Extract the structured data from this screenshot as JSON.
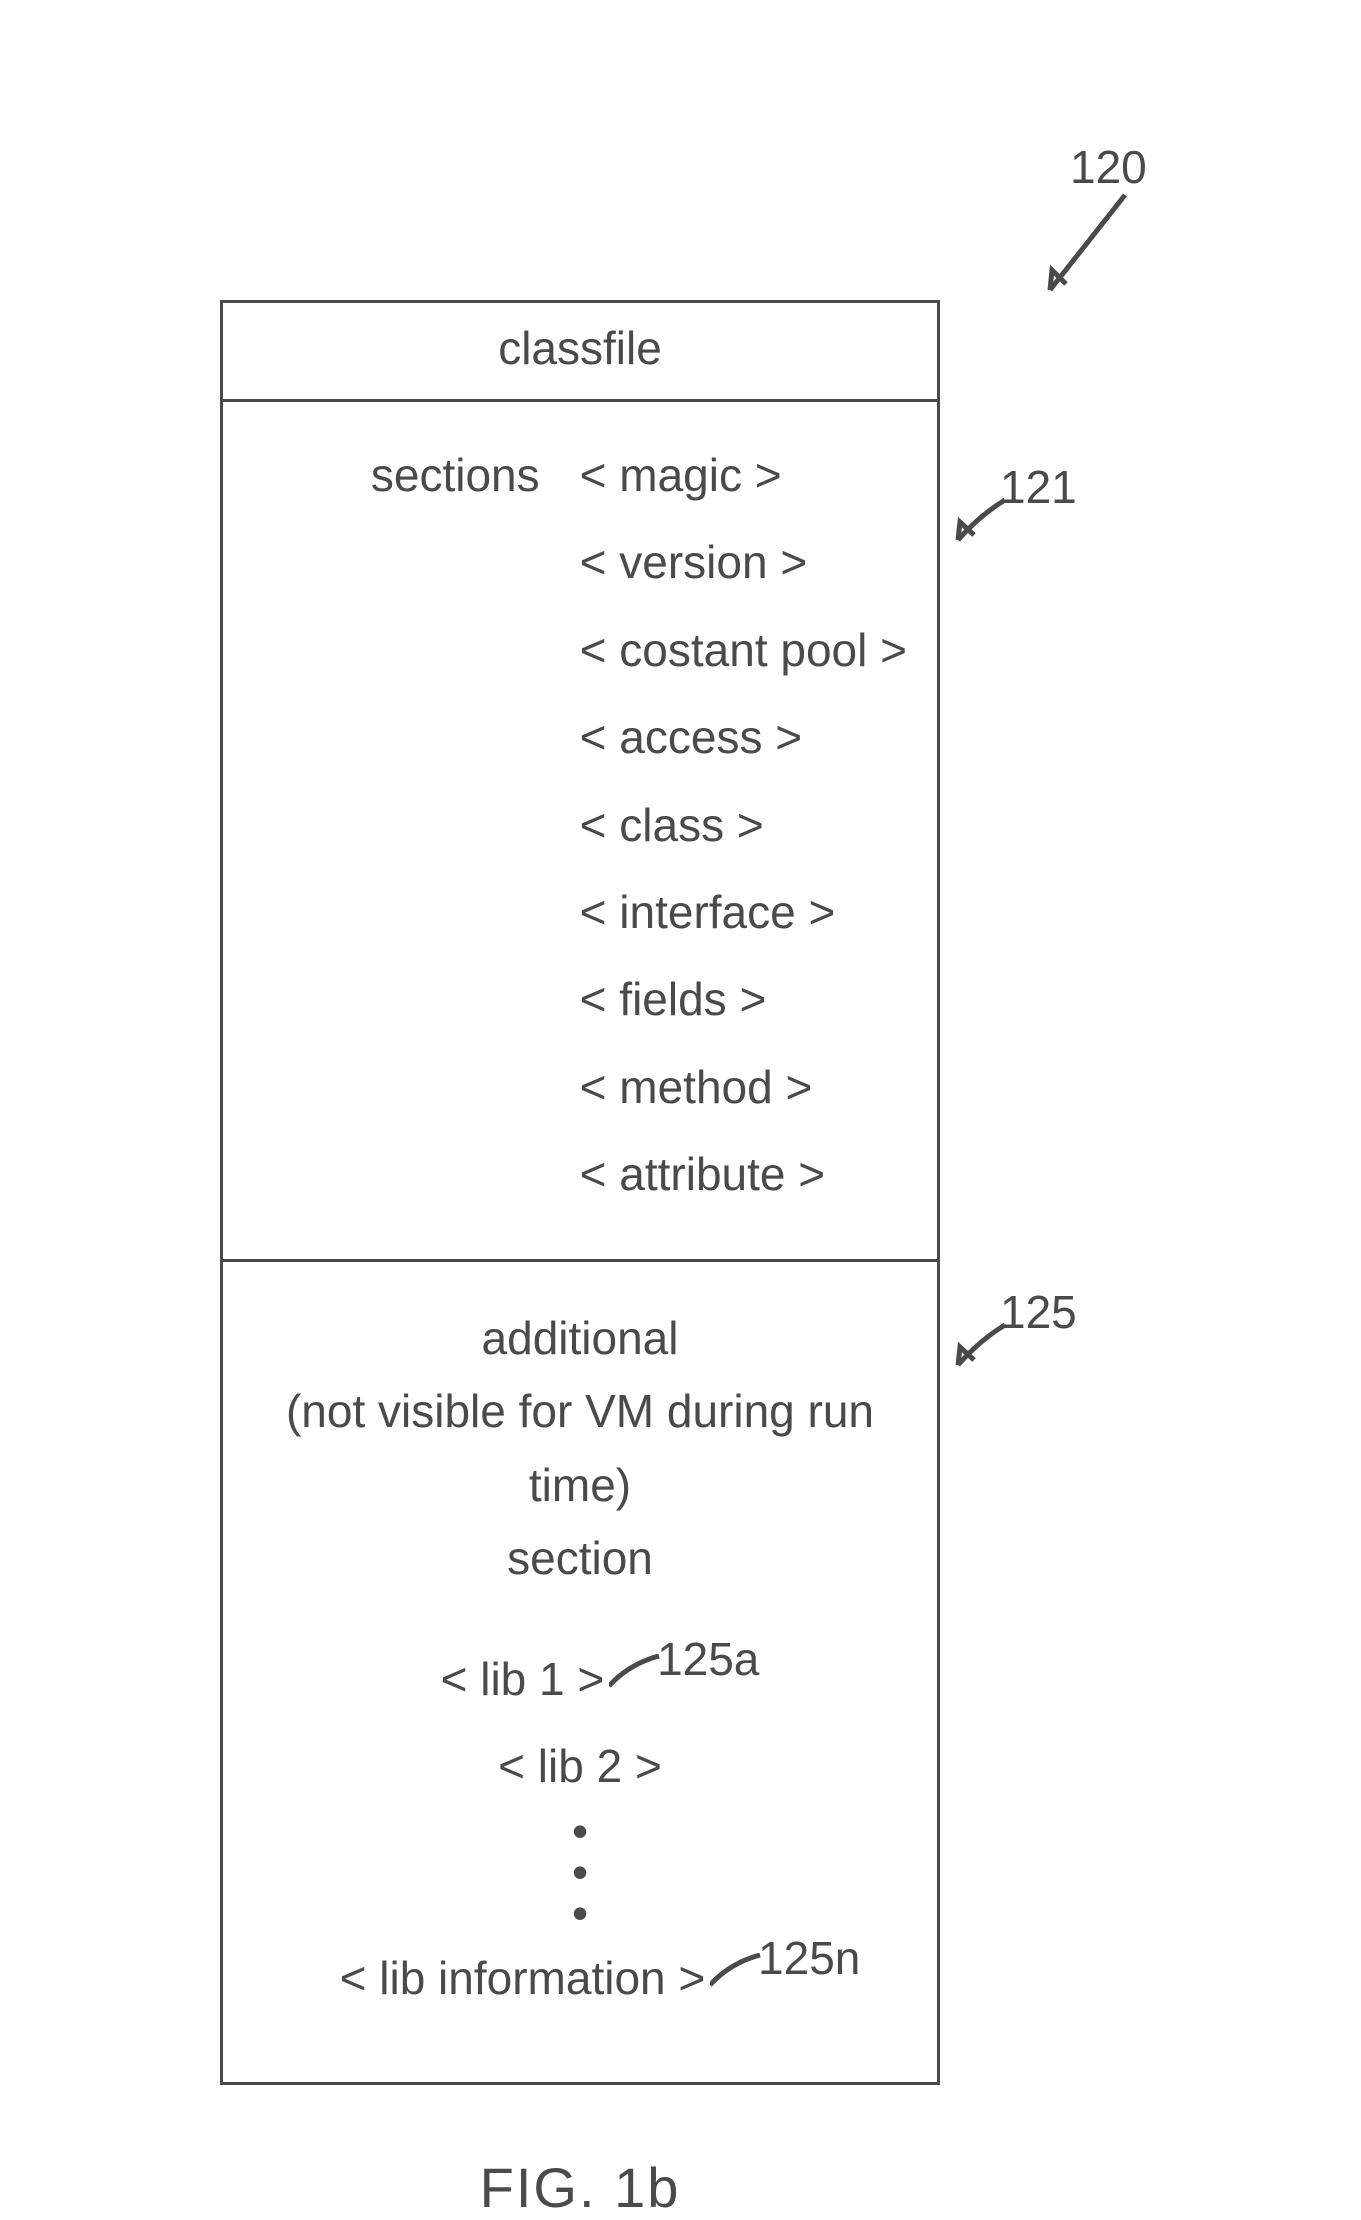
{
  "title": "classfile",
  "sections_label": "sections",
  "sections": [
    "< magic >",
    "< version >",
    "< costant pool >",
    "< access >",
    "< class >",
    "< interface >",
    "< fields >",
    "< method >",
    "< attribute >"
  ],
  "additional": {
    "line1": "additional",
    "line2": "(not visible for VM during run time)",
    "line3": "section",
    "libs": [
      "< lib 1 >",
      "< lib 2 >"
    ],
    "lib_info": "< lib information >"
  },
  "refs": {
    "r120": "120",
    "r121": "121",
    "r125": "125",
    "r125a": "125a",
    "r125n": "125n"
  },
  "caption": "FIG. 1b"
}
